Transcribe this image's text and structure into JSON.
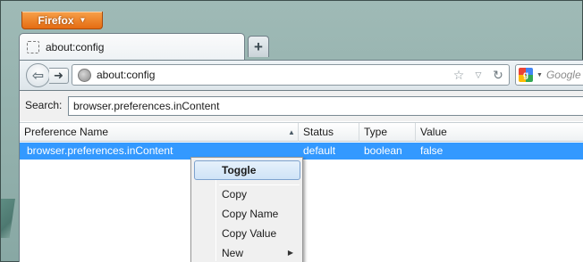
{
  "app": {
    "menu_button": "Firefox",
    "menu_button_icon": "chevron-down-icon"
  },
  "tabs": [
    {
      "label": "about:config",
      "icon": "blank-page-icon"
    }
  ],
  "new_tab_icon": "plus-icon",
  "navigation": {
    "back_icon": "back-arrow-icon",
    "forward_icon": "forward-arrow-icon",
    "url": "about:config",
    "url_icon": "globe-icon",
    "bookmark_icon": "star-icon",
    "history_icon": "dropmarker-icon",
    "reload_icon": "reload-icon"
  },
  "search": {
    "engine_icon": "google-icon",
    "placeholder": "Google"
  },
  "config": {
    "filter_label": "Search:",
    "filter_value": "browser.preferences.inContent",
    "columns": [
      "Preference Name",
      "Status",
      "Type",
      "Value"
    ],
    "rows": [
      {
        "name": "browser.preferences.inContent",
        "status": "default",
        "type": "boolean",
        "value": "false",
        "selected": true
      }
    ]
  },
  "context_menu": {
    "items": [
      {
        "label": "Toggle",
        "highlighted": true
      },
      {
        "label": "Copy"
      },
      {
        "label": "Copy Name"
      },
      {
        "label": "Copy Value"
      },
      {
        "label": "New",
        "has_submenu": true
      }
    ]
  },
  "colors": {
    "selection": "#3399ff",
    "firefox_button": "#e56c12"
  }
}
